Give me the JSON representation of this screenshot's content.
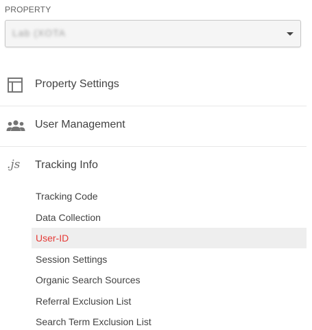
{
  "property": {
    "label": "PROPERTY",
    "selected_value": "Lab (XOTA"
  },
  "sections": [
    {
      "label": "Property Settings",
      "icon": "layout-icon"
    },
    {
      "label": "User Management",
      "icon": "people-icon"
    },
    {
      "label": "Tracking Info",
      "icon": "js-icon",
      "icon_text": ".js"
    }
  ],
  "tracking_items": [
    {
      "label": "Tracking Code",
      "active": false
    },
    {
      "label": "Data Collection",
      "active": false
    },
    {
      "label": "User-ID",
      "active": true
    },
    {
      "label": "Session Settings",
      "active": false
    },
    {
      "label": "Organic Search Sources",
      "active": false
    },
    {
      "label": "Referral Exclusion List",
      "active": false
    },
    {
      "label": "Search Term Exclusion List",
      "active": false
    }
  ],
  "colors": {
    "active_text": "#e53935",
    "active_bg": "#eeeeee",
    "icon": "#757575"
  }
}
